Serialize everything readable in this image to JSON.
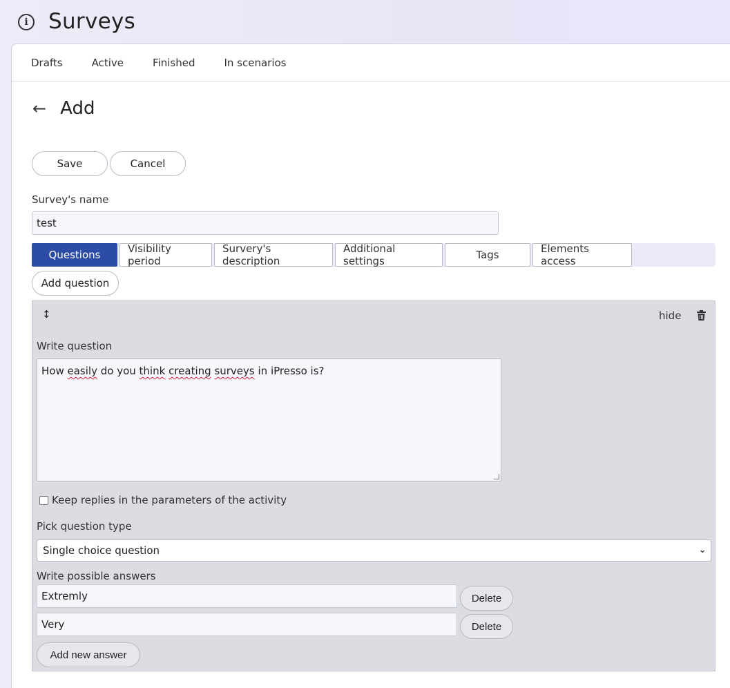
{
  "header": {
    "title": "Surveys",
    "icon": "info-icon"
  },
  "top_tabs": [
    "Drafts",
    "Active",
    "Finished",
    "In scenarios"
  ],
  "sub_header": {
    "title": "Add",
    "back_icon": "arrow-left-icon"
  },
  "actions": {
    "save_label": "Save",
    "cancel_label": "Cancel"
  },
  "survey_name": {
    "label": "Survey's name",
    "value": "test"
  },
  "section_tabs": {
    "active": "Questions",
    "items": [
      "Questions",
      "Visibility period",
      "Survery's description",
      "Additional settings",
      "Tags",
      "Elements access"
    ]
  },
  "add_question_label": "Add question",
  "question": {
    "drag_icon": "drag-vertical-icon",
    "hide_label": "hide",
    "delete_icon": "trash-icon",
    "write_label": "Write question",
    "text_parts": [
      "How ",
      "easily",
      " do you ",
      "think",
      " ",
      "creating",
      " ",
      "surveys",
      " in iPresso is?"
    ],
    "keep_replies_label": "Keep replies in the parameters of the activity",
    "keep_replies_checked": false,
    "type_label": "Pick question type",
    "type_value": "Single choice question",
    "answers_label": "Write possible answers",
    "answers": [
      "Extremly",
      "Very"
    ],
    "delete_label": "Delete",
    "add_answer_label": "Add new answer"
  },
  "colors": {
    "accent": "#2d4ca6",
    "spellcheck": "#dd2233"
  }
}
